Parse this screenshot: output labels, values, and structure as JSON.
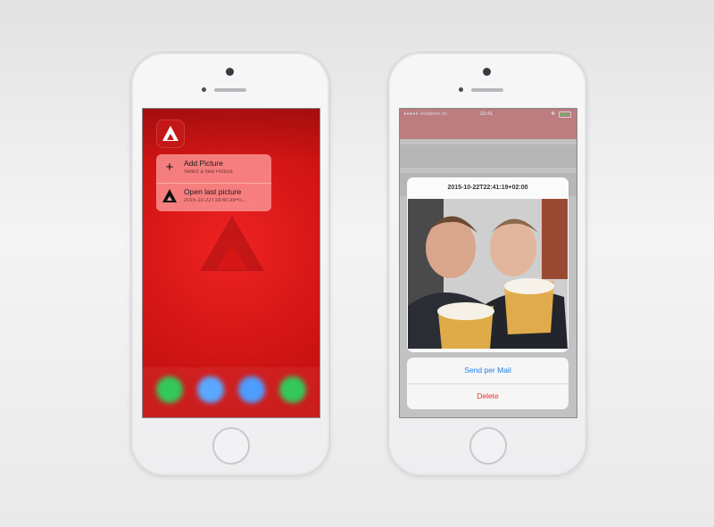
{
  "left_phone": {
    "quick_actions": [
      {
        "title": "Add Picture",
        "subtitle": "Select a new Picture",
        "icon": "plus-icon"
      },
      {
        "title": "Open last picture",
        "subtitle": "2015-10-22T18:40:39+0...",
        "icon": "app-triangle-icon"
      }
    ],
    "colors": {
      "background": "#d81616",
      "menu": "#ff9f9f"
    }
  },
  "right_phone": {
    "status_bar": {
      "carrier": "●●●●● Vodafone.de",
      "time": "22:41"
    },
    "alert": {
      "title": "2015-10-22T22:41:19+02:00"
    },
    "action_sheet": {
      "send_mail": "Send per Mail",
      "delete": "Delete"
    },
    "colors": {
      "accent": "#1e7ff0",
      "destructive": "#f03030",
      "nav": "#e07f85"
    }
  }
}
